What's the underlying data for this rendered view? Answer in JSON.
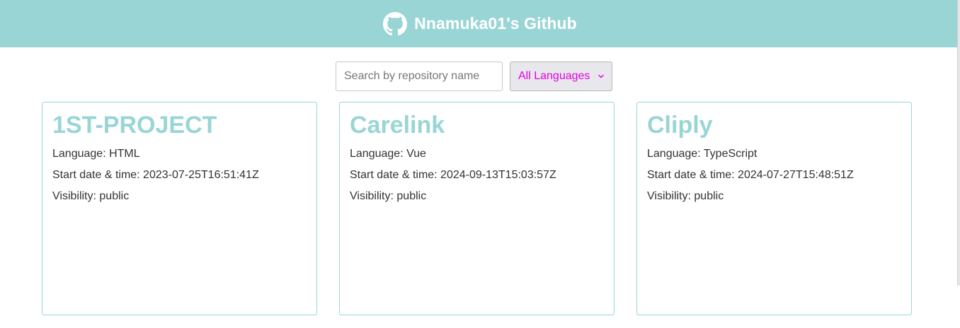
{
  "header": {
    "title": "Nnamuka01's Github",
    "icon": "github-icon",
    "bg_color": "#9ad5d6"
  },
  "controls": {
    "search_placeholder": "Search by repository name",
    "search_value": "",
    "language_selected": "All Languages"
  },
  "repos": [
    {
      "name": "1ST-PROJECT",
      "language": "Language: HTML",
      "start": "Start date & time: 2023-07-25T16:51:41Z",
      "visibility": "Visibility: public"
    },
    {
      "name": "Carelink",
      "language": "Language: Vue",
      "start": "Start date & time: 2024-09-13T15:03:57Z",
      "visibility": "Visibility: public"
    },
    {
      "name": "Cliply",
      "language": "Language: TypeScript",
      "start": "Start date & time: 2024-07-27T15:48:51Z",
      "visibility": "Visibility: public"
    }
  ],
  "colors": {
    "accent": "#9ad5d6",
    "select_text": "#e400e4"
  }
}
